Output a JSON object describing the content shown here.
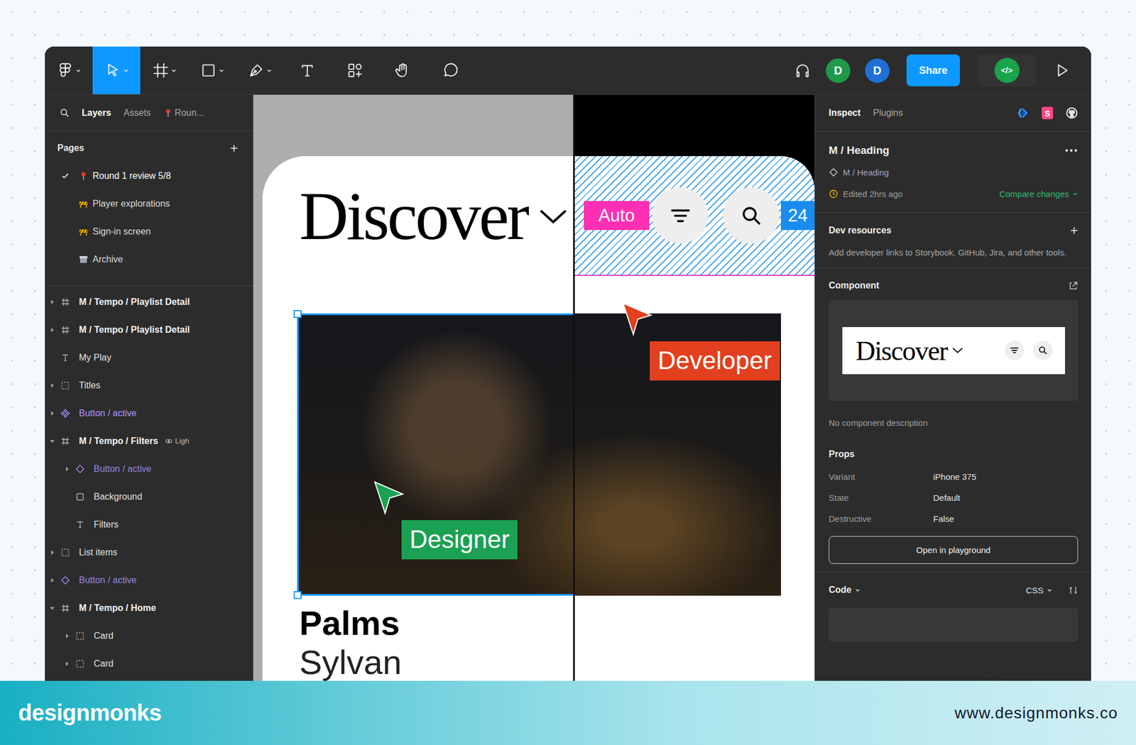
{
  "toolbar": {
    "tools": [
      {
        "kind": "main-menu",
        "dropdown": true,
        "selected": false
      },
      {
        "kind": "move",
        "dropdown": true,
        "selected": true
      },
      {
        "kind": "frame",
        "dropdown": true,
        "selected": false
      },
      {
        "kind": "shape",
        "dropdown": true,
        "selected": false
      },
      {
        "kind": "pen",
        "dropdown": true,
        "selected": false
      },
      {
        "kind": "text",
        "dropdown": false,
        "selected": false
      },
      {
        "kind": "resources",
        "dropdown": false,
        "selected": false
      },
      {
        "kind": "hand",
        "dropdown": false,
        "selected": false
      },
      {
        "kind": "comment",
        "dropdown": false,
        "selected": false
      }
    ],
    "avatars": [
      {
        "initial": "D",
        "color": "#1f9a4a"
      },
      {
        "initial": "D",
        "color": "#1f6fd6"
      }
    ],
    "share": "Share",
    "dev_mode": {
      "label": "</>",
      "on": true
    }
  },
  "left_panel": {
    "tabs": [
      {
        "label": "Layers",
        "selected": true,
        "icon": "none"
      },
      {
        "label": "Assets",
        "selected": false,
        "icon": "none"
      },
      {
        "label": "Roun...",
        "selected": false,
        "icon": "pin"
      }
    ],
    "pages_title": "Pages",
    "add": "+",
    "pages": [
      {
        "name": "Round 1 review 5/8",
        "icon": "pin",
        "selected": true
      },
      {
        "name": "Player explorations",
        "icon": "construction",
        "selected": false
      },
      {
        "name": "Sign-in screen",
        "icon": "construction",
        "selected": false
      },
      {
        "name": "Archive",
        "icon": "archive",
        "selected": false
      }
    ],
    "layers": [
      {
        "name": "M / Tempo / Playlist Detail",
        "kind": "frame",
        "depth": 0,
        "has_children": true,
        "expanded": false
      },
      {
        "name": "M / Tempo / Playlist Detail",
        "kind": "frame",
        "depth": 0,
        "has_children": true,
        "expanded": false
      },
      {
        "name": "My Play",
        "kind": "text",
        "depth": 0,
        "has_children": false,
        "expanded": false
      },
      {
        "name": "Titles",
        "kind": "group",
        "depth": 0,
        "has_children": true,
        "expanded": false
      },
      {
        "name": "Button / active",
        "kind": "component",
        "depth": 0,
        "has_children": true,
        "expanded": false
      },
      {
        "name": "M / Tempo / Filters",
        "kind": "frame",
        "depth": 0,
        "has_children": true,
        "expanded": true,
        "badge": "Ligh"
      },
      {
        "name": "Button / active",
        "kind": "instance",
        "depth": 1,
        "has_children": true,
        "expanded": false
      },
      {
        "name": "Background",
        "kind": "rect",
        "depth": 1,
        "has_children": false,
        "expanded": false
      },
      {
        "name": "Filters",
        "kind": "text",
        "depth": 1,
        "has_children": false,
        "expanded": false
      },
      {
        "name": "List items",
        "kind": "group",
        "depth": 0,
        "has_children": true,
        "expanded": false
      },
      {
        "name": "Button / active",
        "kind": "instance",
        "depth": 0,
        "has_children": true,
        "expanded": false
      },
      {
        "name": "M / Tempo / Home",
        "kind": "frame",
        "depth": 0,
        "has_children": true,
        "expanded": true
      },
      {
        "name": "Card",
        "kind": "group",
        "depth": 1,
        "has_children": true,
        "expanded": false
      },
      {
        "name": "Card",
        "kind": "group",
        "depth": 1,
        "has_children": true,
        "expanded": false
      }
    ]
  },
  "canvas": {
    "heading": "Discover",
    "auto_tag": "Auto",
    "spacing_tag": "24",
    "title": "Palms",
    "subtitle": "Sylvan",
    "image_selected": true,
    "cursors": [
      {
        "label": "Designer",
        "kind": "design",
        "color": "#1ba153"
      },
      {
        "label": "Developer",
        "kind": "dev",
        "color": "#e2401f"
      }
    ]
  },
  "inspect": {
    "tabs": [
      {
        "label": "Inspect",
        "selected": true
      },
      {
        "label": "Plugins",
        "selected": false
      }
    ],
    "integrations": [
      {
        "kind": "jira",
        "label": ""
      },
      {
        "kind": "storybook",
        "label": "S"
      },
      {
        "kind": "github",
        "label": ""
      }
    ],
    "title": "M / Heading",
    "component_link": "M / Heading",
    "edited": "Edited 2hrs ago",
    "compare": "Compare changes",
    "dev_resources": {
      "title": "Dev resources",
      "add": "+",
      "description": "Add developer links to Storybook, GitHub, Jira, and other tools."
    },
    "component": {
      "title": "Component",
      "preview_heading": "Discover",
      "description": "No component description"
    },
    "props": {
      "title": "Props",
      "rows": [
        {
          "name": "Variant",
          "value": "iPhone 375"
        },
        {
          "name": "State",
          "value": "Default"
        },
        {
          "name": "Destructive",
          "value": "False"
        }
      ]
    },
    "playground": "Open in playground",
    "code": {
      "title": "Code",
      "language": "CSS"
    }
  },
  "footer": {
    "brand": "designmonks",
    "url": "www.designmonks.co"
  }
}
